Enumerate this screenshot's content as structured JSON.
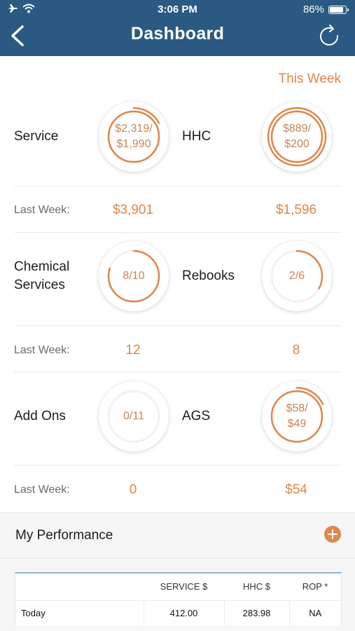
{
  "status_bar": {
    "time": "3:06 PM",
    "battery": "86%",
    "battery_level": 0.86
  },
  "nav": {
    "title": "Dashboard",
    "back_icon": "chevron-left-icon",
    "refresh_icon": "refresh-icon"
  },
  "period": {
    "label": "This Week"
  },
  "metrics": [
    {
      "label_lines": [
        "Service"
      ],
      "value_lines": [
        "$2,319/",
        "$1,990"
      ],
      "progress": 1.0,
      "overflow": 0.17
    },
    {
      "label_lines": [
        "HHC"
      ],
      "value_lines": [
        "$889/",
        "$200"
      ],
      "progress": 1.0,
      "overflow": 1.0
    },
    {
      "label_lines": [
        "Chemical",
        "Services"
      ],
      "value_lines": [
        "8/10"
      ],
      "progress": 0.8,
      "overflow": 0
    },
    {
      "label_lines": [
        "Rebooks"
      ],
      "value_lines": [
        "2/6"
      ],
      "progress": 0.33,
      "overflow": 0
    },
    {
      "label_lines": [
        "Add Ons"
      ],
      "value_lines": [
        "0/11"
      ],
      "progress": 0.0,
      "overflow": 0
    },
    {
      "label_lines": [
        "AGS"
      ],
      "value_lines": [
        "$58/",
        "$49"
      ],
      "progress": 1.0,
      "overflow": 0.18
    }
  ],
  "last_week": {
    "label": "Last Week:",
    "rows": [
      [
        "$3,901",
        "$1,596"
      ],
      [
        "12",
        "8"
      ],
      [
        "0",
        "$54"
      ]
    ]
  },
  "performance": {
    "title": "My Performance",
    "add_icon": "plus-circle-icon",
    "columns": [
      "",
      "SERVICE $",
      "HHC $",
      "ROP *"
    ],
    "rows": [
      [
        "Today",
        "412.00",
        "283.98",
        "NA"
      ]
    ]
  },
  "colors": {
    "accent": "#e0874a",
    "header": "#2a5a81",
    "ring_track": "#f2f2f2"
  }
}
